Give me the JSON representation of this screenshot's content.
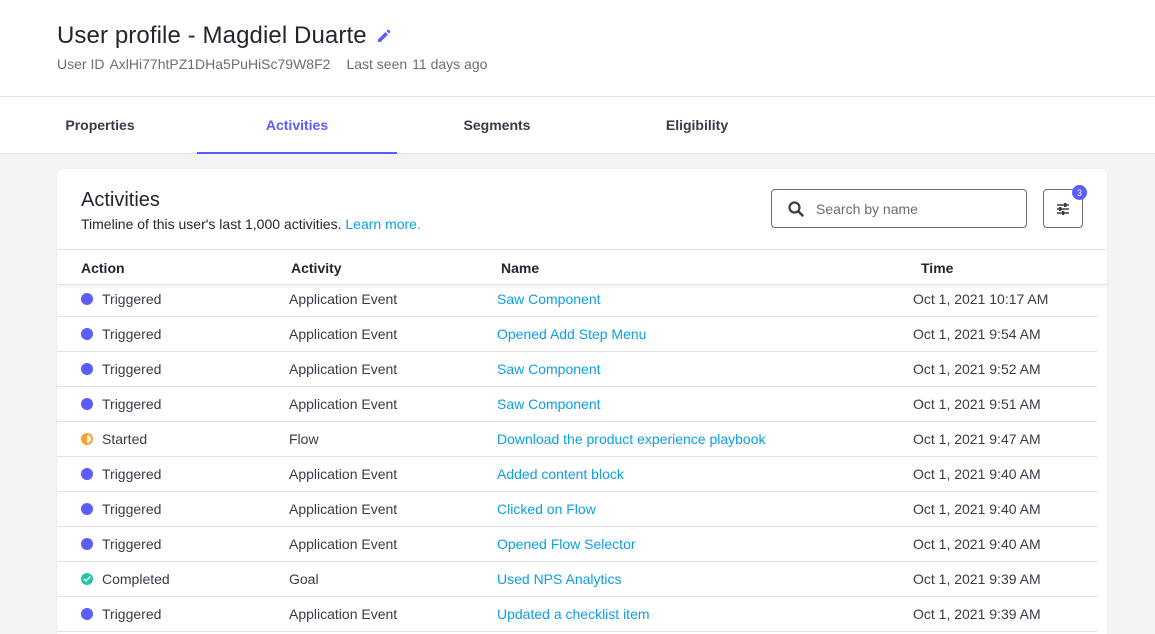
{
  "header": {
    "title": "User profile - Magdiel Duarte",
    "user_id_label": "User ID",
    "user_id": "AxlHi77htPZ1DHa5PuHiSc79W8F2",
    "last_seen_label": "Last seen",
    "last_seen": "11 days ago"
  },
  "tabs": [
    {
      "label": "Properties",
      "active": false
    },
    {
      "label": "Activities",
      "active": true
    },
    {
      "label": "Segments",
      "active": false
    },
    {
      "label": "Eligibility",
      "active": false
    }
  ],
  "activities": {
    "title": "Activities",
    "subtitle": "Timeline of this user's last 1,000 activities.",
    "learn_more": "Learn more.",
    "search_placeholder": "Search by name",
    "filter_count": "3",
    "columns": [
      "Action",
      "Activity",
      "Name",
      "Time"
    ],
    "rows": [
      {
        "action": "Triggered",
        "status": "triggered",
        "activity": "Application Event",
        "name": "Saw Component",
        "time": "Oct 1, 2021 10:17 AM"
      },
      {
        "action": "Triggered",
        "status": "triggered",
        "activity": "Application Event",
        "name": "Opened Add Step Menu",
        "time": "Oct 1, 2021 9:54 AM"
      },
      {
        "action": "Triggered",
        "status": "triggered",
        "activity": "Application Event",
        "name": "Saw Component",
        "time": "Oct 1, 2021 9:52 AM"
      },
      {
        "action": "Triggered",
        "status": "triggered",
        "activity": "Application Event",
        "name": "Saw Component",
        "time": "Oct 1, 2021 9:51 AM"
      },
      {
        "action": "Started",
        "status": "started",
        "activity": "Flow",
        "name": "Download the product experience playbook",
        "time": "Oct 1, 2021 9:47 AM"
      },
      {
        "action": "Triggered",
        "status": "triggered",
        "activity": "Application Event",
        "name": "Added content block",
        "time": "Oct 1, 2021 9:40 AM"
      },
      {
        "action": "Triggered",
        "status": "triggered",
        "activity": "Application Event",
        "name": "Clicked on Flow",
        "time": "Oct 1, 2021 9:40 AM"
      },
      {
        "action": "Triggered",
        "status": "triggered",
        "activity": "Application Event",
        "name": "Opened Flow Selector",
        "time": "Oct 1, 2021 9:40 AM"
      },
      {
        "action": "Completed",
        "status": "completed",
        "activity": "Goal",
        "name": "Used NPS Analytics",
        "time": "Oct 1, 2021 9:39 AM"
      },
      {
        "action": "Triggered",
        "status": "triggered",
        "activity": "Application Event",
        "name": "Updated a checklist item",
        "time": "Oct 1, 2021 9:39 AM"
      }
    ]
  },
  "colors": {
    "accent": "#5c5cff",
    "link": "#0d9ee6",
    "started": "#ff9f2e",
    "completed": "#1fc7a6"
  },
  "icons": {
    "edit": "pencil-icon",
    "search": "search-icon",
    "filter": "sliders-icon",
    "completed": "check-icon"
  }
}
